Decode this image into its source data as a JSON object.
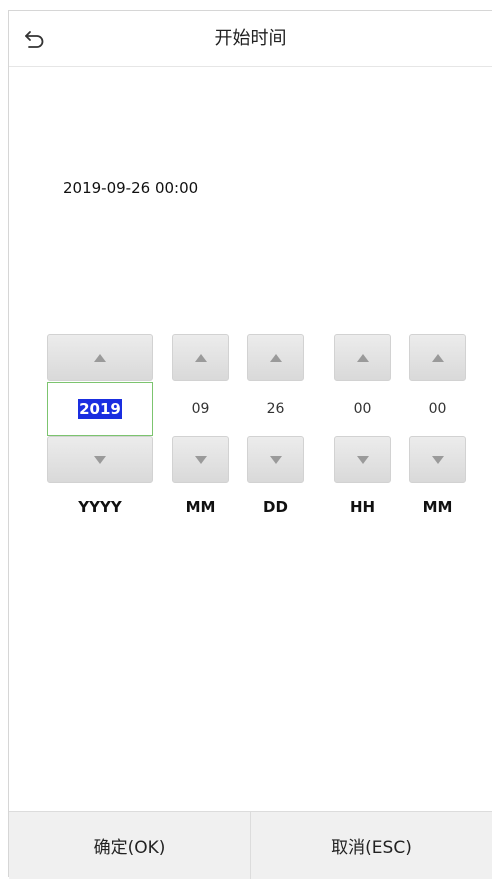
{
  "header": {
    "title": "开始时间",
    "back_icon": "back-arrow-icon"
  },
  "display": {
    "datetime": "2019-09-26 00:00"
  },
  "fields": [
    {
      "key": "year",
      "label": "YYYY",
      "value": "2019",
      "active": true
    },
    {
      "key": "month",
      "label": "MM",
      "value": "09",
      "active": false
    },
    {
      "key": "day",
      "label": "DD",
      "value": "26",
      "active": false
    },
    {
      "key": "hour",
      "label": "HH",
      "value": "00",
      "active": false
    },
    {
      "key": "minute",
      "label": "MM",
      "value": "00",
      "active": false
    }
  ],
  "footer": {
    "ok_label": "确定(OK)",
    "cancel_label": "取消(ESC)"
  },
  "colors": {
    "selection": "#1a2ee0",
    "active_border": "#7cc46f",
    "button_gray": "#dedede",
    "footer_bg": "#f0f0f0"
  }
}
